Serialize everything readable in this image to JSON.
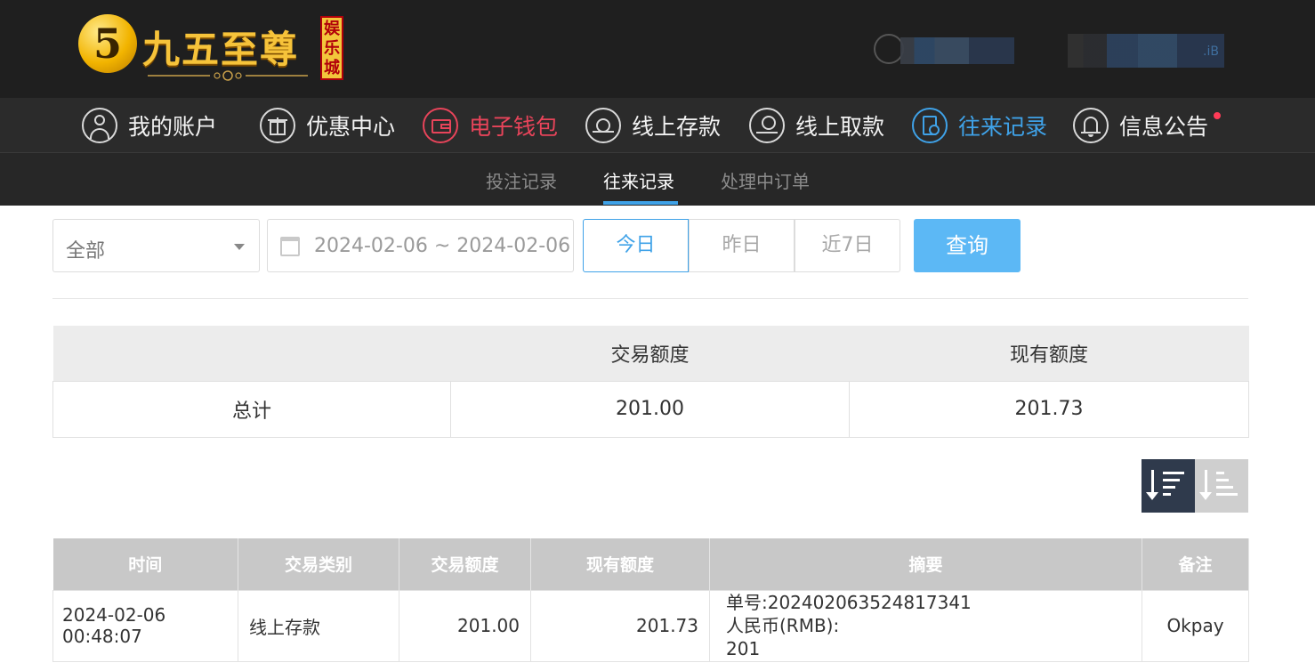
{
  "brand": {
    "digit": "5",
    "name": "九五至尊",
    "badge": [
      "娱",
      "乐",
      "城"
    ]
  },
  "user": {
    "suffix": ".iB"
  },
  "nav": [
    {
      "label": "我的账户",
      "icon": "user-icon",
      "state": "normal"
    },
    {
      "label": "优惠中心",
      "icon": "gift-icon",
      "state": "normal"
    },
    {
      "label": "电子钱包",
      "icon": "wallet-icon",
      "state": "highlight"
    },
    {
      "label": "线上存款",
      "icon": "deposit-icon",
      "state": "normal"
    },
    {
      "label": "线上取款",
      "icon": "withdraw-icon",
      "state": "normal"
    },
    {
      "label": "往来记录",
      "icon": "records-icon",
      "state": "active"
    },
    {
      "label": "信息公告",
      "icon": "bell-icon",
      "state": "normal"
    }
  ],
  "subnav": [
    {
      "label": "投注记录",
      "active": false
    },
    {
      "label": "往来记录",
      "active": true
    },
    {
      "label": "处理中订单",
      "active": false
    }
  ],
  "filters": {
    "type_value": "全部",
    "date_range": "2024-02-06 ~ 2024-02-06",
    "quick": [
      "今日",
      "昨日",
      "近7日"
    ],
    "quick_active": "今日",
    "search_label": "查询"
  },
  "summary": {
    "headers": [
      "",
      "交易额度",
      "现有额度"
    ],
    "row": {
      "label": "总计",
      "amount": "201.00",
      "balance": "201.73"
    }
  },
  "sort": {
    "active": "desc"
  },
  "records": {
    "headers": [
      "时间",
      "交易类别",
      "交易额度",
      "现有额度",
      "摘要",
      "备注"
    ],
    "rows": [
      {
        "time": "2024-02-06 00:48:07",
        "type": "线上存款",
        "amount": "201.00",
        "balance": "201.73",
        "summary_lines": [
          "单号:202402063524817341",
          "人民币(RMB):",
          "201"
        ],
        "note": "Okpay"
      }
    ]
  },
  "colors": {
    "accent": "#3fa2e8",
    "highlight": "#e8445a",
    "search_button": "#5cb8f5",
    "header_bg": "#1f1f1f"
  }
}
